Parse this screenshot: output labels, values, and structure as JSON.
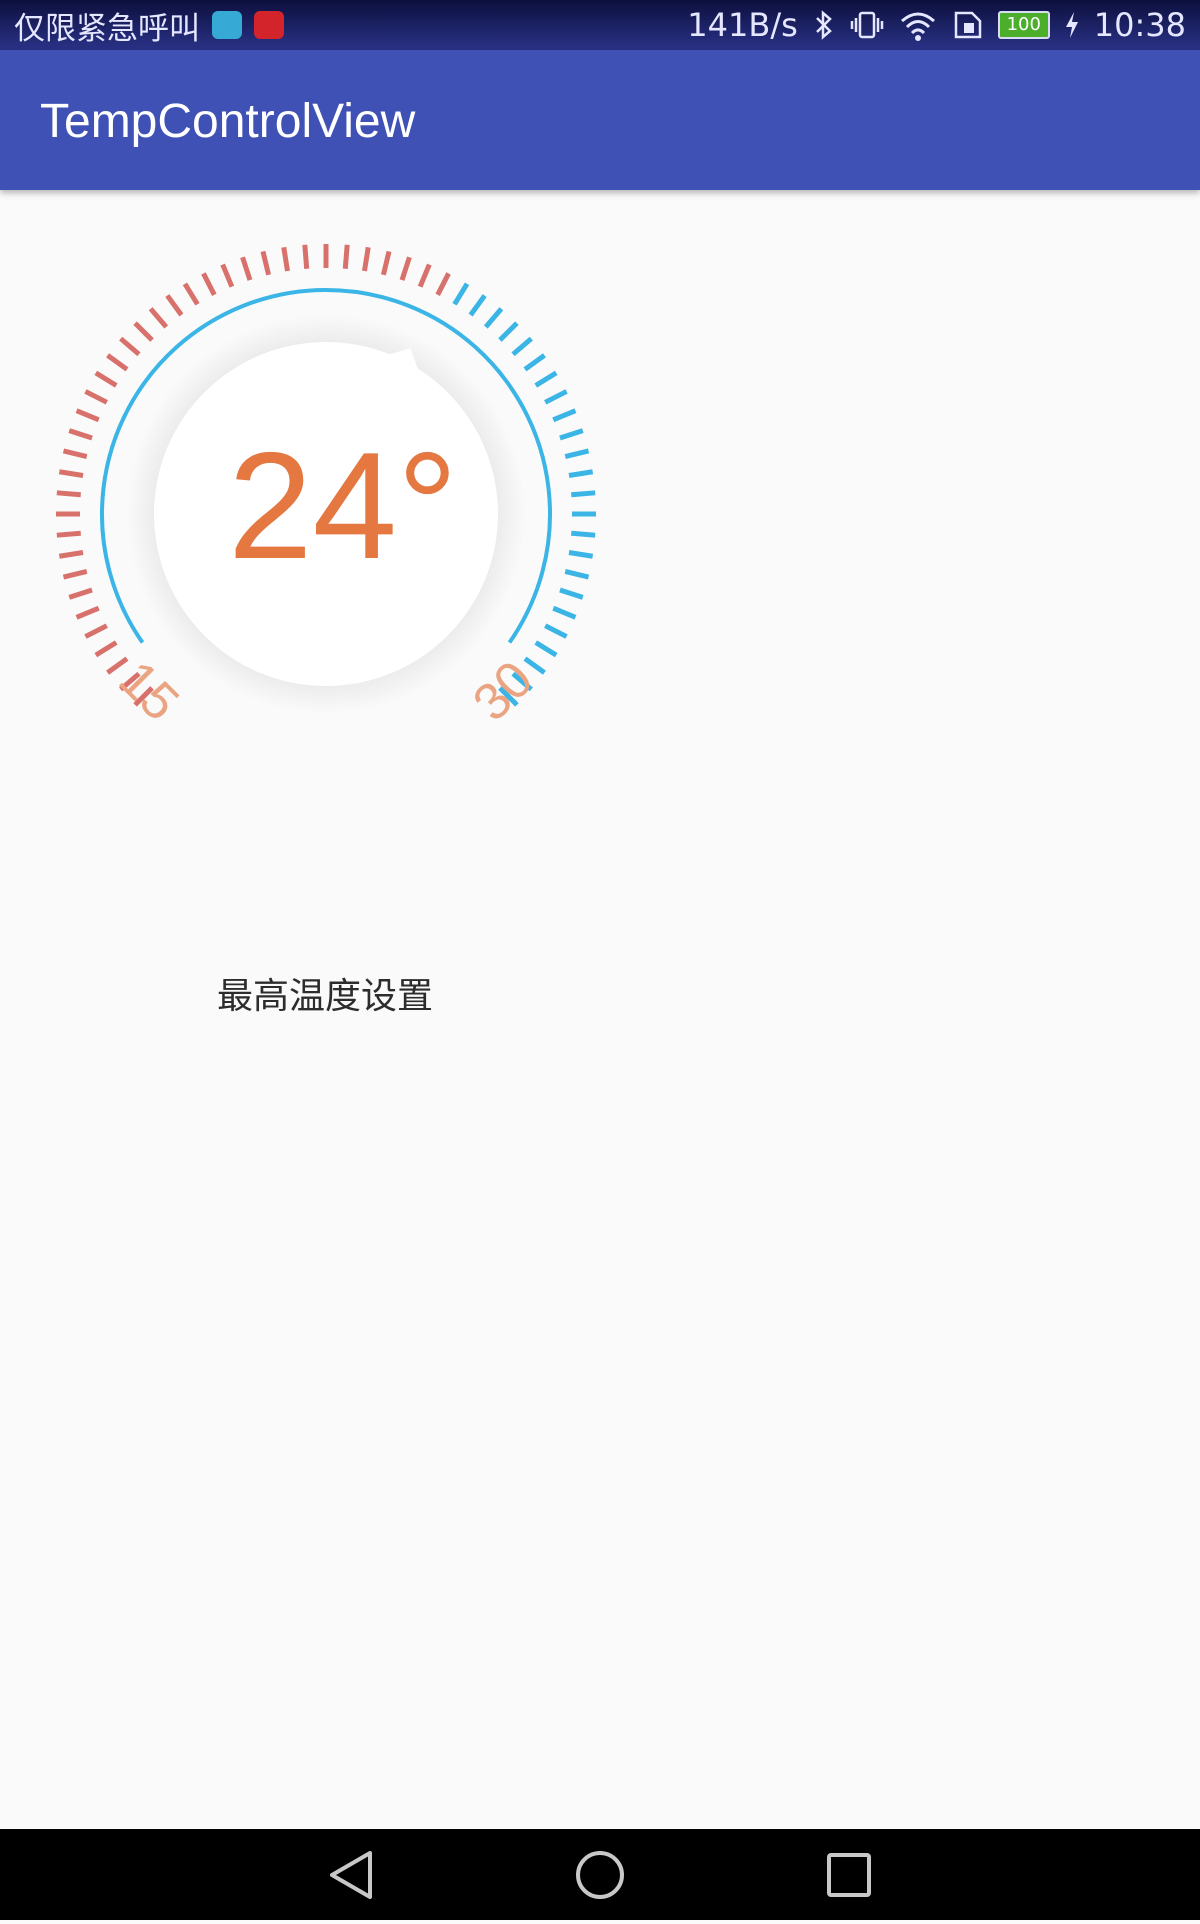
{
  "status_bar": {
    "carrier": "仅限紧急呼叫",
    "speed": "141B/s",
    "battery": "100",
    "time": "10:38",
    "icons": [
      "android-notification-icon",
      "huawei-notification-icon",
      "bluetooth-icon",
      "vibrate-icon",
      "wifi-icon",
      "sim-icon",
      "battery-icon",
      "charging-icon"
    ]
  },
  "app_bar": {
    "title": "TempControlView"
  },
  "temp_control": {
    "value": "24°",
    "min_label": "15",
    "max_label": "30",
    "title": "最高温度设置",
    "level_fraction": 0.6
  },
  "colors": {
    "primary": "#3f51b5",
    "tick_warm": "#d8716b",
    "tick_cool": "#3ab5e6",
    "value_text": "#e47840",
    "scale_label": "#eaa482"
  },
  "nav_bar": {
    "icons": [
      "back-icon",
      "home-icon",
      "recents-icon"
    ]
  }
}
